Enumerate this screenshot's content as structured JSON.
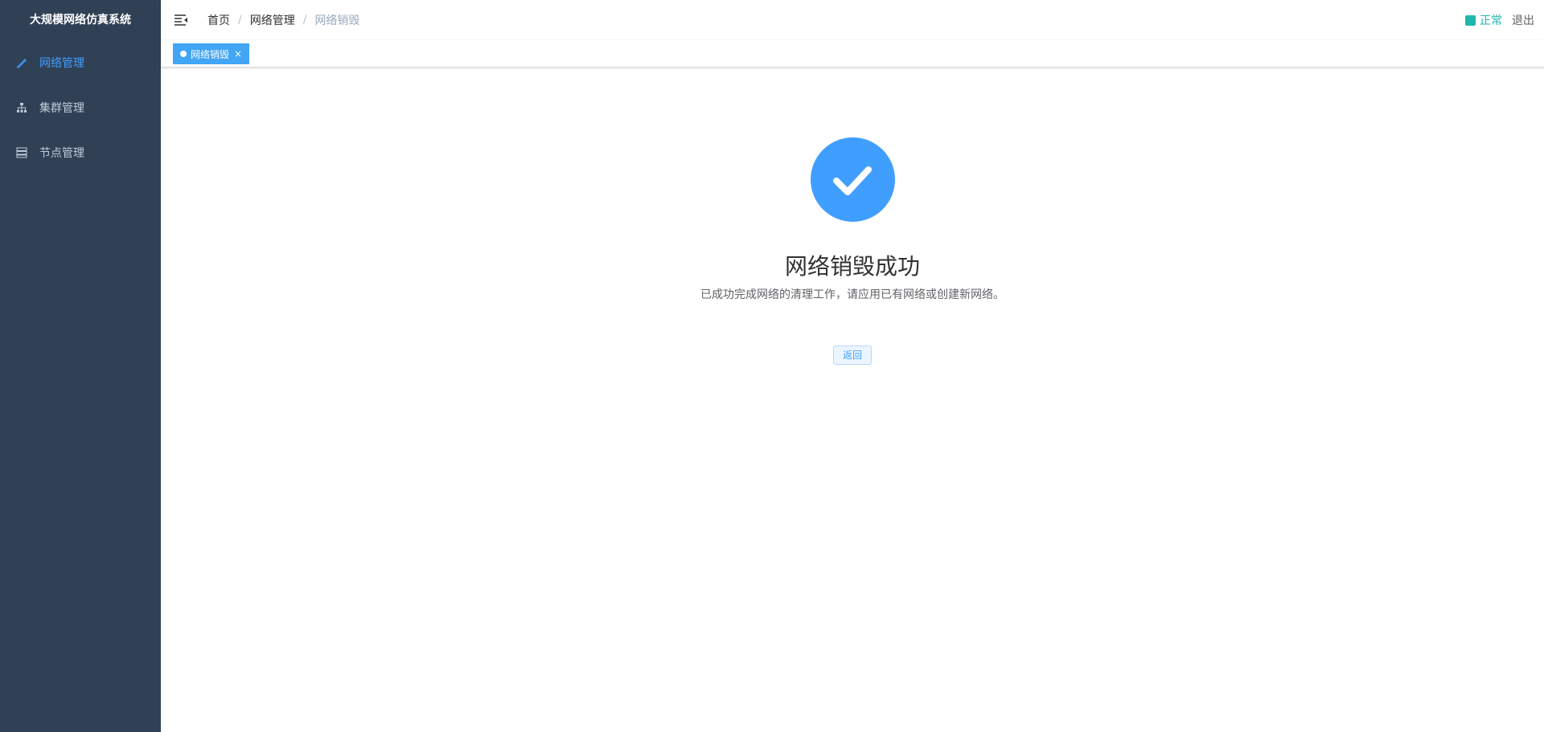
{
  "app": {
    "title": "大规模网络仿真系统"
  },
  "sidebar": {
    "items": [
      {
        "label": "网络管理",
        "icon": "pen-icon",
        "active": true
      },
      {
        "label": "集群管理",
        "icon": "tree-icon",
        "active": false
      },
      {
        "label": "节点管理",
        "icon": "server-icon",
        "active": false
      }
    ]
  },
  "breadcrumb": [
    "首页",
    "网络管理",
    "网络销毁"
  ],
  "header": {
    "status": "正常",
    "logout": "退出",
    "status_color": "#1fb6ac"
  },
  "tags": [
    {
      "label": "网络销毁",
      "close": "×"
    }
  ],
  "result": {
    "title": "网络销毁成功",
    "subtitle": "已成功完成网络的清理工作，请应用已有网络或创建新网络。",
    "button": "返回",
    "icon": "check-circle-icon",
    "accent": "#409eff"
  }
}
